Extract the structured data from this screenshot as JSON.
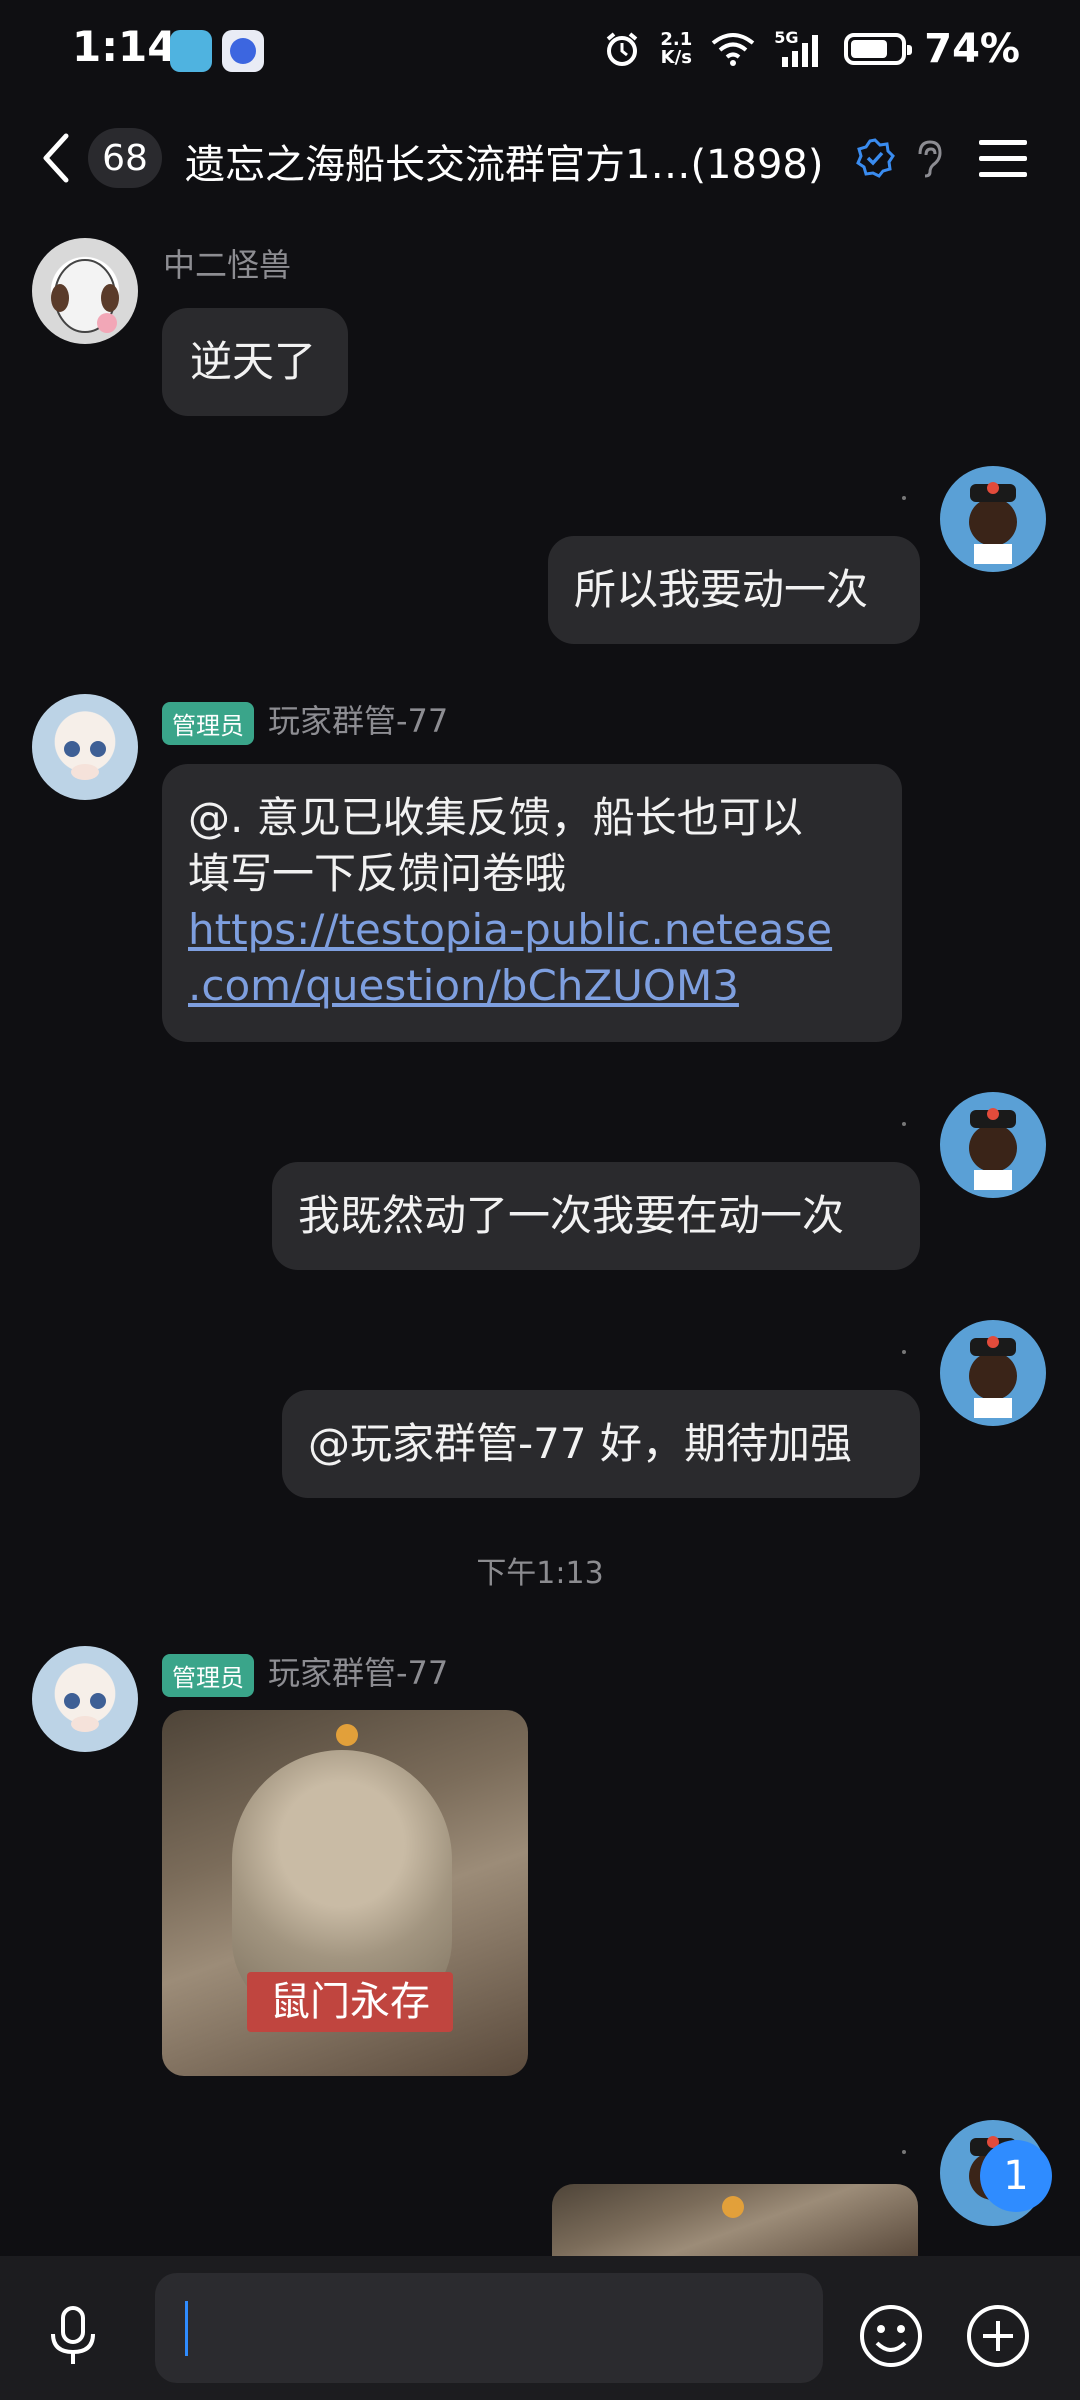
{
  "status_bar": {
    "time": "1:14",
    "net_speed_top": "2.1",
    "net_speed_bottom": "K/s",
    "network": "5G",
    "battery": "74%",
    "battery_level": 0.74
  },
  "header": {
    "unread_count": "68",
    "title": "遗忘之海船长交流群官方1…(1898)"
  },
  "messages": {
    "m1": {
      "sender": "中二怪兽",
      "text": "逆天了"
    },
    "m2": {
      "text": "所以我要动一次"
    },
    "m3": {
      "badge": "管理员",
      "sender": "玩家群管-77",
      "text_line1": "@. 意见已收集反馈，船长也可以",
      "text_line2": "填写一下反馈问卷哦",
      "link_line1": "https://testopia-public.netease",
      "link_line2": ".com/question/bChZUOM3"
    },
    "m4": {
      "text": "我既然动了一次我要在动一次"
    },
    "m5": {
      "text": "@玩家群管-77 好，期待加强"
    },
    "time_separator": "下午1:13",
    "m6": {
      "badge": "管理员",
      "sender": "玩家群管-77",
      "image_caption": "鼠门永存"
    }
  },
  "floating_badge": "1",
  "input": {
    "placeholder": ""
  },
  "colors": {
    "accent": "#2f8cff",
    "admin_badge": "#3aa58a",
    "link": "#7e9fdf",
    "background": "#0f0f12",
    "bubble": "#2a2a2d"
  }
}
